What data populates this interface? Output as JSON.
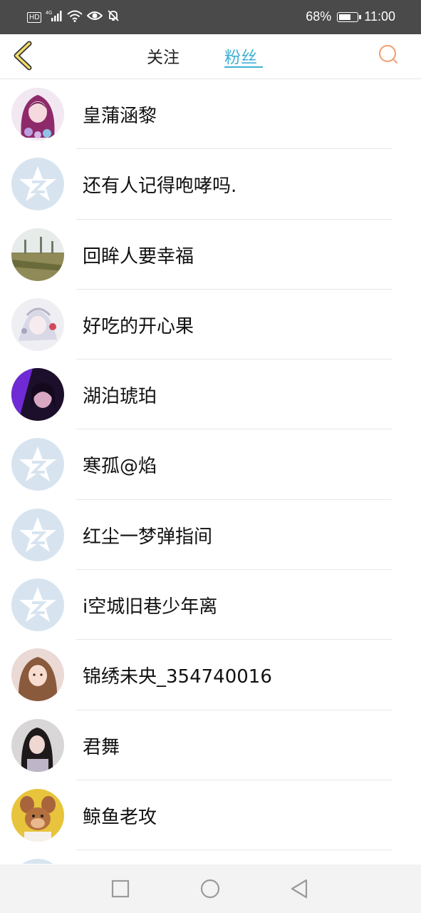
{
  "status_bar": {
    "left_icons": [
      "hd-icon",
      "signal-4g-icon",
      "wifi-icon",
      "eye-icon",
      "bell-off-icon"
    ],
    "hd_label": "HD",
    "net_label": "4G",
    "battery_percent": "68%",
    "battery_level": 0.68,
    "time": "11:00"
  },
  "header": {
    "tabs": [
      {
        "label": "关注",
        "active": false
      },
      {
        "label": "粉丝",
        "active": true
      }
    ],
    "accent_color": "#3fb0d4"
  },
  "fans": [
    {
      "name": "皇蒲涵黎",
      "avatar": "anime-girl-avatar"
    },
    {
      "name": "还有人记得咆哮吗.",
      "avatar": "default-qzone-avatar"
    },
    {
      "name": "回眸人要幸福",
      "avatar": "landscape-avatar"
    },
    {
      "name": "好吃的开心果",
      "avatar": "white-illustration-avatar"
    },
    {
      "name": "湖泊琥珀",
      "avatar": "purple-selfie-avatar"
    },
    {
      "name": "寒孤@焰",
      "avatar": "default-qzone-avatar"
    },
    {
      "name": "红尘一梦弹指间",
      "avatar": "default-qzone-avatar"
    },
    {
      "name": "i空城旧巷少年离",
      "avatar": "default-qzone-avatar"
    },
    {
      "name": "锦绣未央_354740016",
      "avatar": "girl-photo-avatar"
    },
    {
      "name": "君舞",
      "avatar": "dark-photo-avatar"
    },
    {
      "name": "鲸鱼老攻",
      "avatar": "cartoon-mouse-avatar"
    },
    {
      "name": "",
      "avatar": "default-qzone-avatar"
    }
  ],
  "nav_bar": {
    "buttons": [
      "recent-apps-icon",
      "home-icon",
      "back-nav-icon"
    ]
  }
}
